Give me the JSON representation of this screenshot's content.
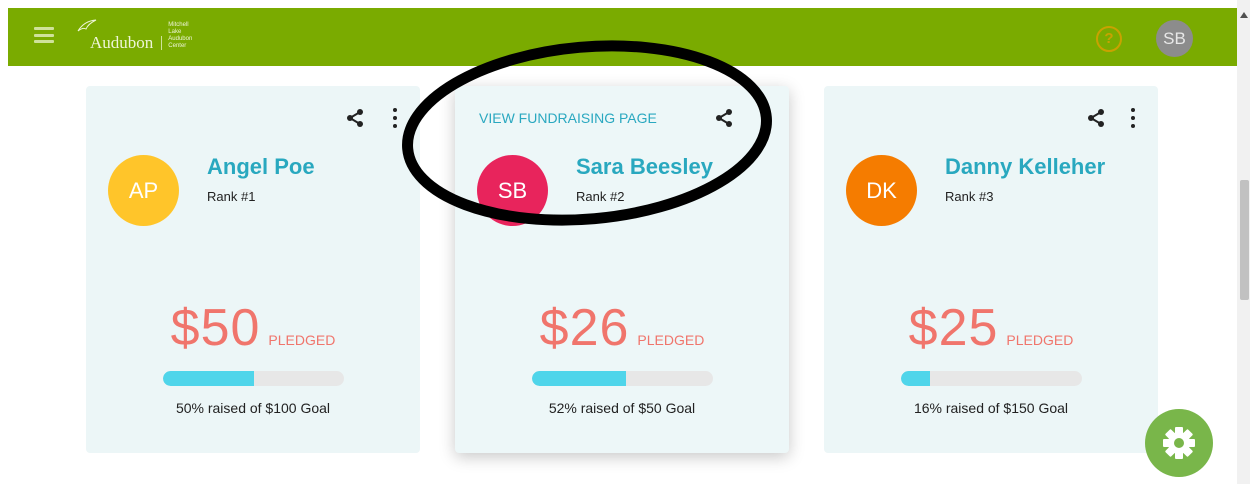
{
  "header": {
    "logo_text": "Audubon",
    "logo_subtitle": "Mitchell Lake Audubon Center",
    "user_initials": "SB"
  },
  "cards": [
    {
      "initials": "AP",
      "name": "Angel Poe",
      "rank": "Rank #1",
      "amount": "$50",
      "pledged_label": "PLEDGED",
      "progress_fraction": 0.5,
      "goal_text": "50% raised of $100 Goal",
      "avatar_color": "#ffc52a"
    },
    {
      "initials": "SB",
      "name": "Sara Beesley",
      "rank": "Rank #2",
      "amount": "$26",
      "pledged_label": "PLEDGED",
      "progress_fraction": 0.52,
      "goal_text": "52% raised of $50 Goal",
      "avatar_color": "#e8245c",
      "view_link": "VIEW FUNDRAISING PAGE"
    },
    {
      "initials": "DK",
      "name": "Danny Kelleher",
      "rank": "Rank #3",
      "amount": "$25",
      "pledged_label": "PLEDGED",
      "progress_fraction": 0.16,
      "goal_text": "16% raised of $150 Goal",
      "avatar_color": "#f57c00"
    }
  ],
  "colors": {
    "header_green": "#7aab00",
    "accent_teal": "#29a8bf",
    "pledge_red": "#f0756c",
    "progress_fill": "#4fd5ea",
    "fab_green": "#79b64a"
  },
  "icons": {
    "menu": "hamburger-menu-icon",
    "help": "help-circle-icon",
    "share": "share-icon",
    "more": "more-vert-icon",
    "settings": "gear-icon"
  }
}
